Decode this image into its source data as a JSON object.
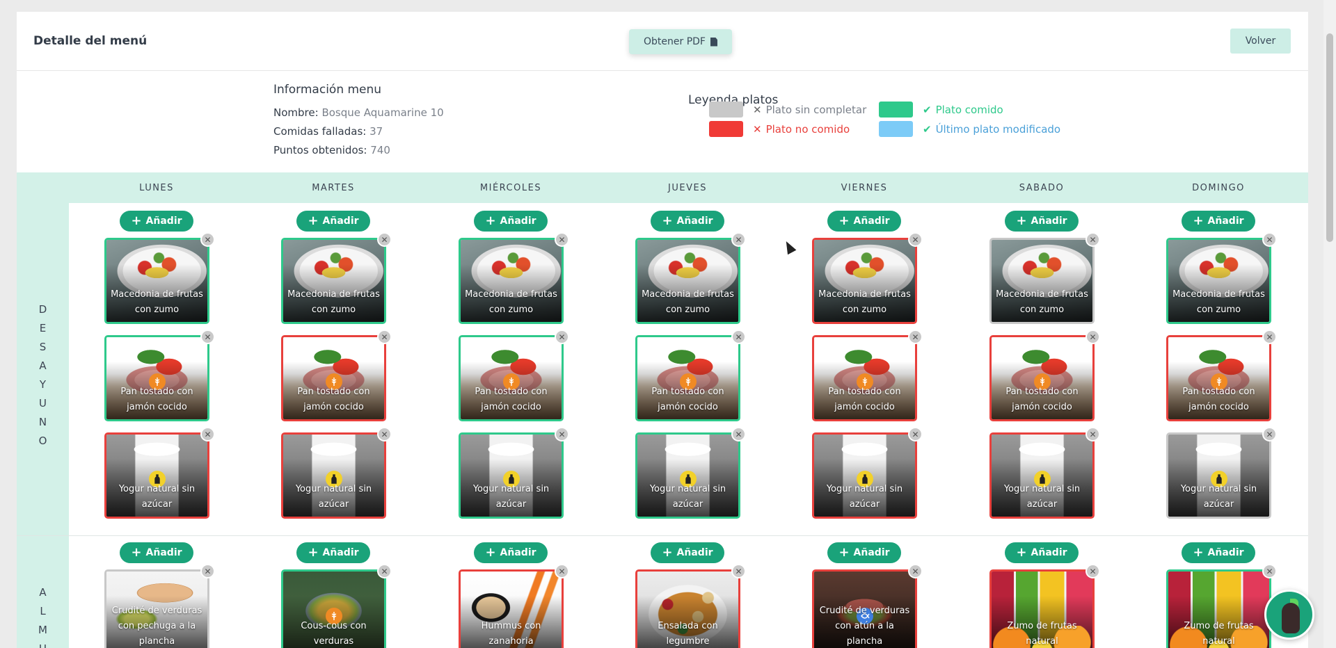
{
  "header": {
    "title": "Detalle del menú",
    "pdf_label": "Obtener PDF",
    "back_label": "Volver"
  },
  "info": {
    "title": "Información menu",
    "name_label": "Nombre:",
    "name_value": "Bosque Aquamarine 10",
    "failed_label": "Comidas falladas:",
    "failed_value": "37",
    "points_label": "Puntos obtenidos:",
    "points_value": "740"
  },
  "legend": {
    "title": "Leyenda platos",
    "items": [
      {
        "label": "Plato sin completar",
        "swatch": "#c8c8c8",
        "mark": "✕",
        "text_color": "#7a808a"
      },
      {
        "label": "Plato comido",
        "swatch": "#2ec98b",
        "mark": "✔",
        "text_color": "#2ec98b"
      },
      {
        "label": "Plato no comido",
        "swatch": "#f03a36",
        "mark": "✕",
        "text_color": "#e8403c"
      },
      {
        "label": "Último plato modificado",
        "swatch": "#7ccbf7",
        "mark": "✔",
        "text_color": "#4aa0d8"
      }
    ]
  },
  "days": [
    "LUNES",
    "MARTES",
    "MIÉRCOLES",
    "JUEVES",
    "VIERNES",
    "SABADO",
    "DOMINGO"
  ],
  "add_label": "Añadir",
  "sections": [
    {
      "letters": [
        "D",
        "E",
        "S",
        "A",
        "Y",
        "U",
        "N",
        "O"
      ],
      "rows": [
        {
          "name": "Macedonia de frutas con zumo",
          "image": "fruit",
          "badge": "",
          "states": [
            "eaten",
            "eaten",
            "eaten",
            "eaten",
            "not_eaten",
            "incomplete",
            "eaten"
          ]
        },
        {
          "name": "Pan tostado con jamón cocido",
          "image": "toast",
          "badge": "wheat",
          "states": [
            "eaten",
            "not_eaten",
            "eaten",
            "eaten",
            "not_eaten",
            "not_eaten",
            "not_eaten"
          ]
        },
        {
          "name": "Yogur natural sin azúcar",
          "image": "yogurt",
          "badge": "bottle",
          "states": [
            "not_eaten",
            "not_eaten",
            "eaten",
            "eaten",
            "not_eaten",
            "not_eaten",
            "incomplete"
          ]
        }
      ]
    },
    {
      "letters": [
        "A",
        "L",
        "M",
        "U"
      ],
      "rows": [
        {
          "cells": [
            {
              "name": "Crudité de verduras con pechuga a la plancha",
              "image": "crudite",
              "badge": "",
              "state": "incomplete"
            },
            {
              "name": "Cous-cous con verduras",
              "image": "couscous",
              "badge": "wheat",
              "state": "eaten"
            },
            {
              "name": "Hummus con zanahoria",
              "image": "hummus",
              "badge": "",
              "state": "not_eaten"
            },
            {
              "name": "Ensalada con legumbre",
              "image": "salad",
              "badge": "",
              "state": "not_eaten"
            },
            {
              "name": "Crudité de verduras con atún a la plancha",
              "image": "tuna",
              "badge": "fish",
              "state": "not_eaten"
            },
            {
              "name": "Zumo de frutas natural",
              "image": "juice",
              "badge": "",
              "state": "not_eaten"
            },
            {
              "name": "Zumo de frutas natural",
              "image": "juice",
              "badge": "",
              "state": "eaten"
            }
          ]
        }
      ]
    }
  ]
}
